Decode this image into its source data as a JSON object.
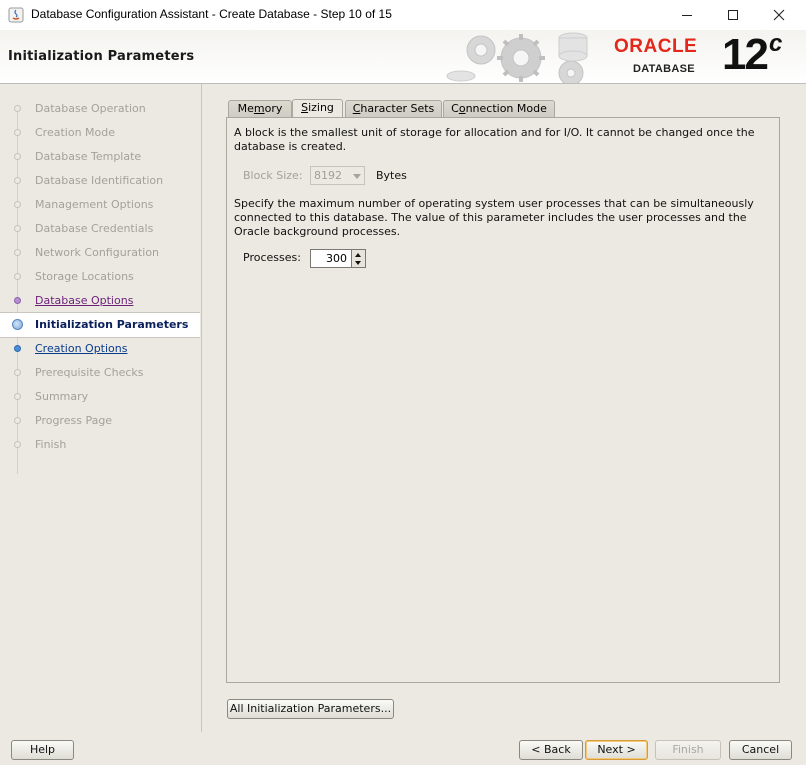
{
  "window": {
    "title": "Database Configuration Assistant - Create Database - Step 10 of 15",
    "controls": [
      "minimize-icon",
      "maximize-icon",
      "close-icon"
    ]
  },
  "header": {
    "page_title": "Initialization Parameters",
    "logo": {
      "brand": "ORACLE",
      "product": "DATABASE",
      "version": "12",
      "version_suffix": "c"
    }
  },
  "steps": [
    {
      "label": "Database Operation",
      "state": "disabled"
    },
    {
      "label": "Creation Mode",
      "state": "disabled"
    },
    {
      "label": "Database Template",
      "state": "disabled"
    },
    {
      "label": "Database Identification",
      "state": "disabled"
    },
    {
      "label": "Management Options",
      "state": "disabled"
    },
    {
      "label": "Database Credentials",
      "state": "disabled"
    },
    {
      "label": "Network Configuration",
      "state": "disabled"
    },
    {
      "label": "Storage Locations",
      "state": "disabled"
    },
    {
      "label": "Database Options",
      "state": "visited"
    },
    {
      "label": "Initialization Parameters",
      "state": "current"
    },
    {
      "label": "Creation Options",
      "state": "link"
    },
    {
      "label": "Prerequisite Checks",
      "state": "disabled"
    },
    {
      "label": "Summary",
      "state": "disabled"
    },
    {
      "label": "Progress Page",
      "state": "disabled"
    },
    {
      "label": "Finish",
      "state": "disabled"
    }
  ],
  "tabs": [
    {
      "pre": "Me",
      "mn": "m",
      "post": "ory",
      "active": false
    },
    {
      "pre": "",
      "mn": "S",
      "post": "izing",
      "active": true
    },
    {
      "pre": "",
      "mn": "C",
      "post": "haracter Sets",
      "active": false
    },
    {
      "pre": "C",
      "mn": "o",
      "post": "nnection Mode",
      "active": false
    }
  ],
  "sizing": {
    "block_desc": "A block is the smallest unit of storage for allocation and for I/O. It cannot be changed once the database is created.",
    "block_size_label": "Block Size:",
    "block_size_value": "8192",
    "block_size_unit": "Bytes",
    "processes_desc": "Specify the maximum number of operating system user processes that can be simultaneously connected to this database. The value of this parameter includes the user processes and the Oracle background processes.",
    "processes_label": "Processes:",
    "processes_value": "300"
  },
  "buttons": {
    "all_params": "All Initialization Parameters...",
    "help": "Help",
    "back": "< Back",
    "next": "Next >",
    "finish": "Finish",
    "cancel": "Cancel"
  },
  "colors": {
    "oracle_red": "#e3271b",
    "visited_link": "#6b1f79",
    "link": "#0b3c8c",
    "disabled_text": "#a3a199"
  }
}
